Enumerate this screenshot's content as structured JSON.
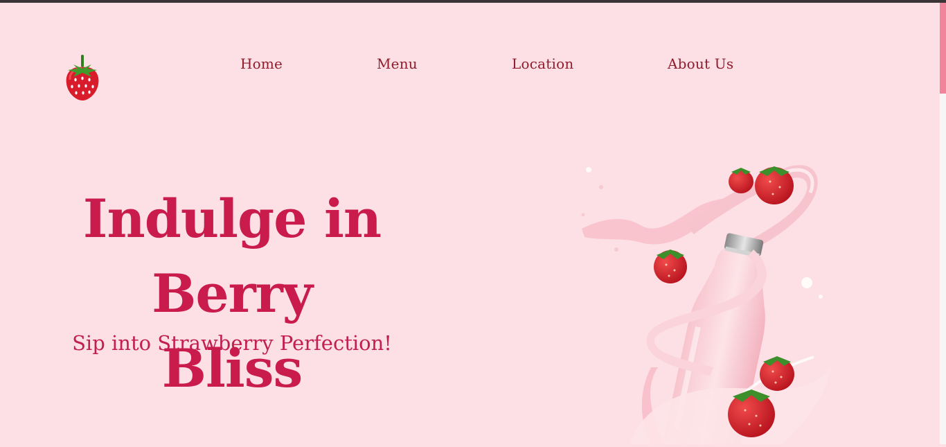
{
  "nav": {
    "items": [
      {
        "label": "Home"
      },
      {
        "label": "Menu"
      },
      {
        "label": "Location"
      },
      {
        "label": "About Us"
      }
    ]
  },
  "hero": {
    "title_line1": "Indulge in Berry",
    "title_line2": "Bliss",
    "subtitle": "Sip into Strawberry Perfection!"
  },
  "icons": {
    "logo": "strawberry-icon",
    "art": "strawberry-milk-bottle"
  },
  "colors": {
    "background": "#fde0e5",
    "nav_text": "#8f1c2b",
    "accent": "#c91c4c"
  }
}
